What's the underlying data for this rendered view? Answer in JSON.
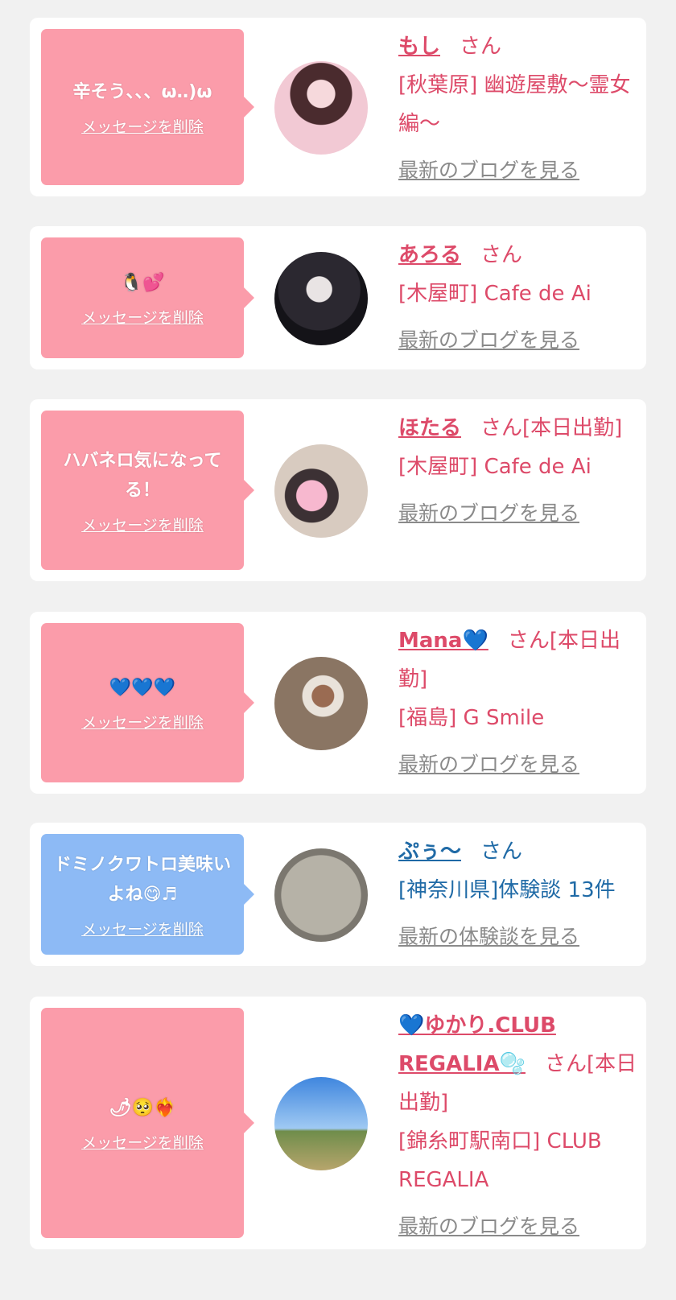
{
  "cards": [
    {
      "message": "辛そう、、、ω‥)ω",
      "delete_label": "メッセージを削除",
      "name": "もし",
      "san": "さん",
      "shop": "[秋葉原] 幽遊屋敷〜霊女編〜",
      "link": "最新のブログを見る",
      "theme": "pink"
    },
    {
      "message": "🐧💕",
      "delete_label": "メッセージを削除",
      "name": "あろる",
      "san": "さん",
      "shop": "[木屋町] Cafe de Ai",
      "link": "最新のブログを見る",
      "theme": "pink"
    },
    {
      "message": "ハバネロ気になってる！",
      "delete_label": "メッセージを削除",
      "name": "ほたる",
      "san": "さん[本日出勤]",
      "shop": "[木屋町] Cafe de Ai",
      "link": "最新のブログを見る",
      "theme": "pink"
    },
    {
      "message": "💙💙💙",
      "delete_label": "メッセージを削除",
      "name": "Mana💙",
      "san": "さん[本日出勤]",
      "shop": "[福島] G Smile",
      "link": "最新のブログを見る",
      "theme": "pink"
    },
    {
      "message": "ドミノクワトロ美味いよね😋♬",
      "delete_label": "メッセージを削除",
      "name": "ぷぅ〜",
      "san": "さん",
      "shop": "[神奈川県]体験談 13件",
      "link": "最新の体験談を見る",
      "theme": "blue"
    },
    {
      "message": "🌶🥺❤️‍🔥",
      "delete_label": "メッセージを削除",
      "name": "💙ゆかり.CLUB REGALIA🫧",
      "san": "さん[本日出勤]",
      "shop": "[錦糸町駅南口] CLUB REGALIA",
      "link": "最新のブログを見る",
      "theme": "pink"
    }
  ]
}
